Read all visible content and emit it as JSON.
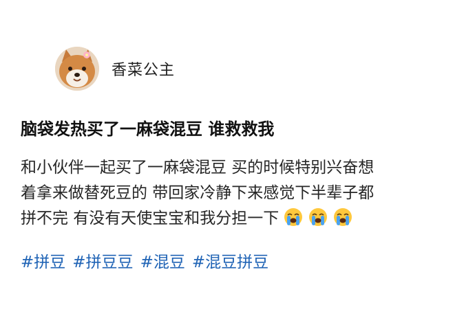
{
  "author": {
    "name": "香菜公主",
    "avatar_icon": "shiba-dog-avatar"
  },
  "post": {
    "title": "脑袋发热买了一麻袋混豆 谁救救我",
    "body_lines": [
      "和小伙伴一起买了一麻袋混豆  买的时候特别兴奋想",
      "着拿来做替死豆的  带回家冷静下来感觉下半辈子都",
      "拼不完 有没有天使宝宝和我分担一下"
    ],
    "emojis": [
      "crying-face-icon",
      "crying-face-icon",
      "crying-face-icon"
    ],
    "tags": [
      "#拼豆",
      "#拼豆豆",
      "#混豆",
      "#混豆拼豆"
    ]
  },
  "colors": {
    "tag": "#1f63b5",
    "text": "#262626",
    "title": "#111111",
    "emoji_face": "#ffc83d",
    "emoji_tears": "#4aa3f0"
  }
}
